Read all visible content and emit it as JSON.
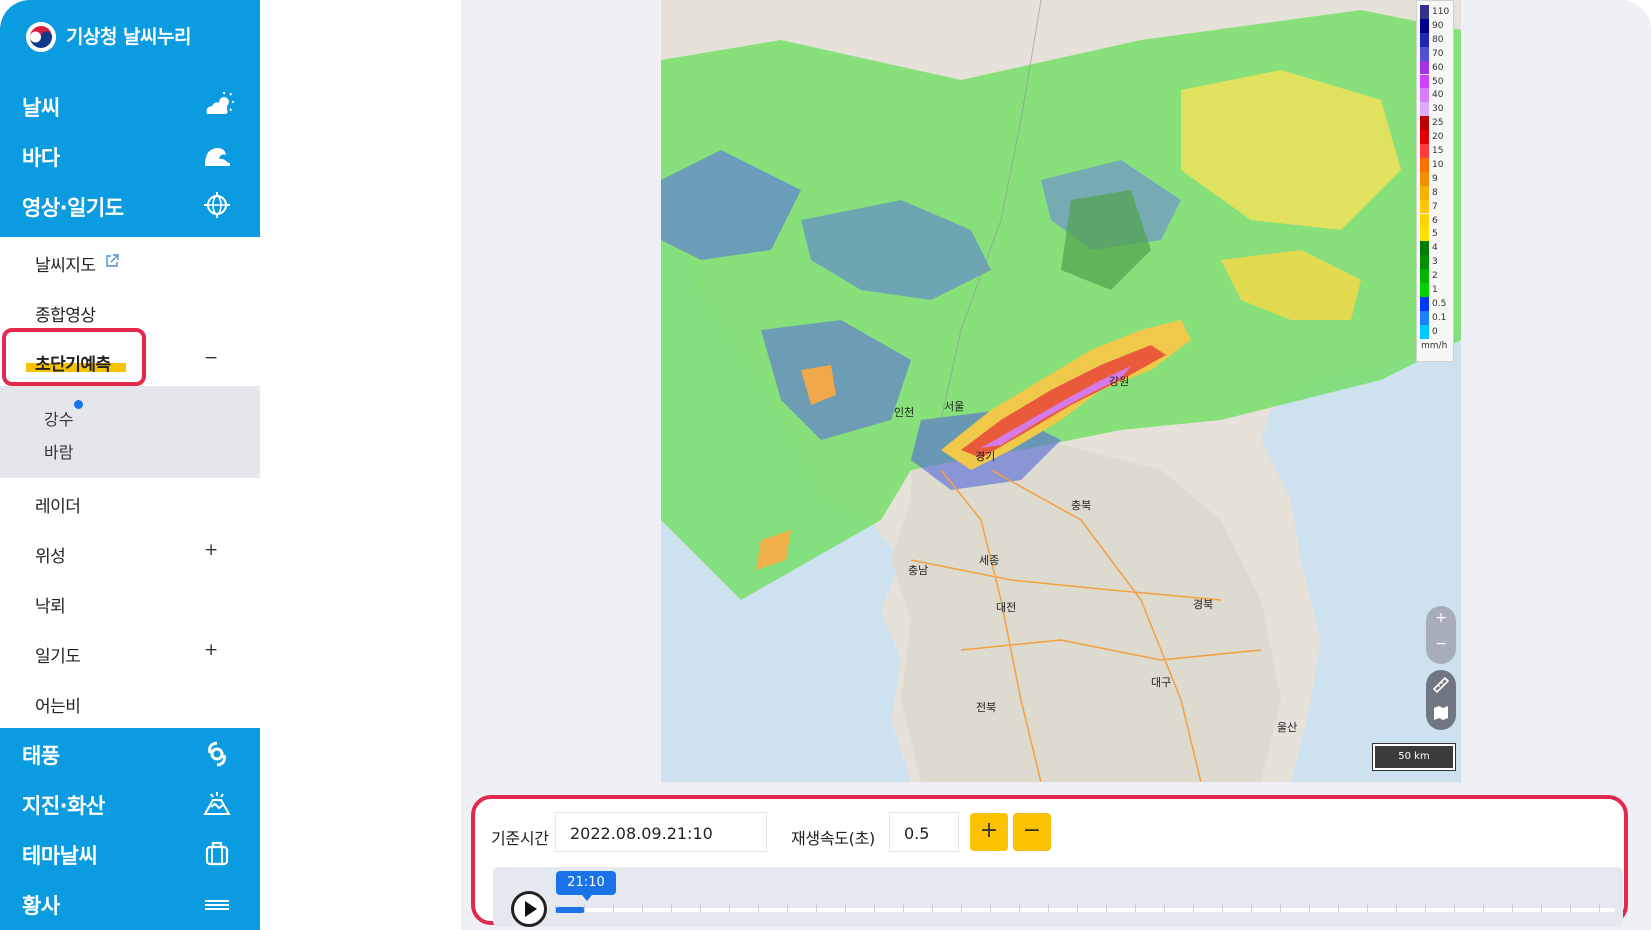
{
  "brand": {
    "title": "기상청 날씨누리"
  },
  "nav": {
    "weather": "날씨",
    "sea": "바다",
    "imagery": "영상·일기도",
    "typhoon": "태풍",
    "quake": "지진·화산",
    "theme": "테마날씨",
    "dust": "황사"
  },
  "sub": {
    "weather_map": "날씨지도",
    "composite": "종합영상",
    "nowcast": "초단기예측",
    "nowcast_sign": "−",
    "rain": "강수",
    "wind": "바람",
    "radar": "레이더",
    "satellite": "위성",
    "satellite_sign": "+",
    "lightning": "낙뢰",
    "chart": "일기도",
    "chart_sign": "+",
    "freezing_rain": "어는비"
  },
  "legend": {
    "unit": "mm/h",
    "ticks": [
      "110",
      "90",
      "80",
      "70",
      "60",
      "50",
      "40",
      "30",
      "25",
      "20",
      "15",
      "10",
      "9",
      "8",
      "7",
      "6",
      "5",
      "4",
      "3",
      "2",
      "1",
      "0.5",
      "0.1",
      "0"
    ],
    "colors": [
      "#33338a",
      "#000090",
      "#1f28b4",
      "#5050d0",
      "#a632e8",
      "#d040ff",
      "#d87cff",
      "#dcaaff",
      "#bd0000",
      "#e60000",
      "#ff3a3a",
      "#ff6e00",
      "#f09000",
      "#f5b200",
      "#ffc800",
      "#ffd400",
      "#ffe200",
      "#007d00",
      "#008f00",
      "#00b400",
      "#00d200",
      "#0038ff",
      "#1980ff",
      "#00c8ff"
    ]
  },
  "map": {
    "labels": [
      "인천",
      "서울",
      "경기",
      "강원",
      "충북",
      "충남",
      "세종",
      "대전",
      "경북",
      "대구",
      "전북",
      "울산"
    ],
    "scale": "50 km",
    "zoom_in": "+",
    "zoom_out": "−"
  },
  "panel": {
    "base_time_label": "기준시간",
    "base_time_value": "2022.08.09.21:10",
    "speed_label": "재생속도(초)",
    "speed_value": "0.5",
    "plus": "+",
    "minus": "−",
    "time_tip": "21:10"
  }
}
